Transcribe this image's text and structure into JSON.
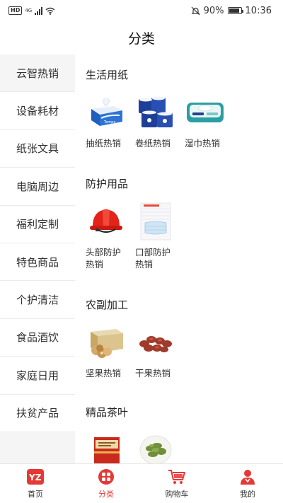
{
  "status_bar": {
    "left_tag": "HD",
    "network": "4G",
    "battery": "90%",
    "battery_level": 0.9,
    "time": "10:36"
  },
  "header": {
    "title": "分类"
  },
  "sidebar": {
    "items": [
      {
        "label": "云智热销",
        "active": true
      },
      {
        "label": "设备耗材"
      },
      {
        "label": "纸张文具"
      },
      {
        "label": "电脑周边"
      },
      {
        "label": "福利定制"
      },
      {
        "label": "特色商品"
      },
      {
        "label": "个护清洁"
      },
      {
        "label": "食品酒饮"
      },
      {
        "label": "家庭日用"
      },
      {
        "label": "扶贫产品"
      }
    ]
  },
  "sections": [
    {
      "title": "生活用纸",
      "products": [
        {
          "name": "抽纸热销",
          "icon": "tissue-box-icon"
        },
        {
          "name": "卷纸热销",
          "icon": "toilet-roll-icon"
        },
        {
          "name": "湿巾热销",
          "icon": "wet-wipes-icon"
        }
      ]
    },
    {
      "title": "防护用品",
      "products": [
        {
          "name": "头部防护热销",
          "line1": "头部防护",
          "line2": "热销",
          "icon": "hard-hat-icon"
        },
        {
          "name": "口部防护热销",
          "line1": "口部防护",
          "line2": "热销",
          "icon": "face-mask-icon"
        }
      ]
    },
    {
      "title": "农副加工",
      "products": [
        {
          "name": "坚果热销",
          "icon": "nuts-icon"
        },
        {
          "name": "干果热销",
          "icon": "dried-fruit-icon"
        }
      ]
    },
    {
      "title": "精品茶叶",
      "products": [
        {
          "name": "",
          "icon": "tea-box-icon"
        },
        {
          "name": "",
          "icon": "green-tea-icon"
        }
      ]
    }
  ],
  "bottom_nav": {
    "items": [
      {
        "label": "首页",
        "icon": "home-logo-icon"
      },
      {
        "label": "分类",
        "icon": "category-icon",
        "active": true
      },
      {
        "label": "购物车",
        "icon": "cart-icon"
      },
      {
        "label": "我的",
        "icon": "profile-icon"
      }
    ]
  },
  "colors": {
    "accent": "#e53935",
    "sidebar_bg": "#f5f5f5",
    "text": "#222222"
  }
}
